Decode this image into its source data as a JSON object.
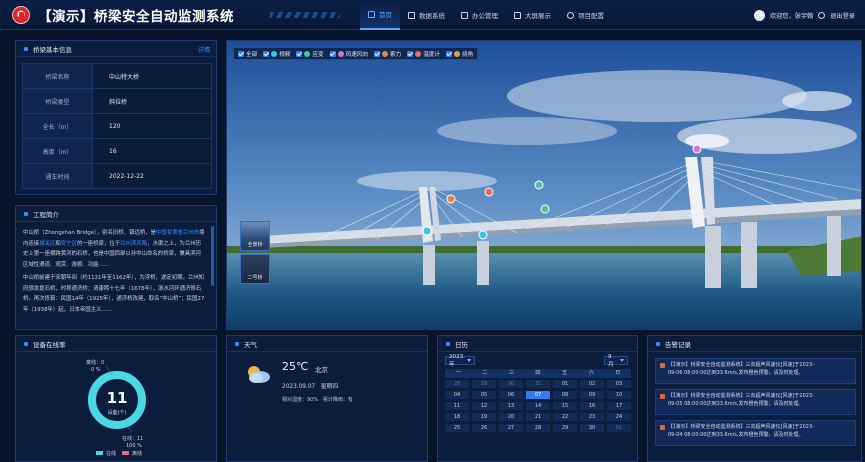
{
  "header": {
    "title": "【演示】桥梁安全自动监测系统",
    "nav": [
      {
        "label": "首页",
        "active": true
      },
      {
        "label": "数据系统",
        "active": false
      },
      {
        "label": "办公管理",
        "active": false
      },
      {
        "label": "大屏展示",
        "active": false
      },
      {
        "label": "项目配置",
        "active": false
      }
    ],
    "welcome": "欢迎您，张宇翰",
    "logout": "退出登录"
  },
  "bridge_info": {
    "title": "桥梁基本信息",
    "detail": "详情",
    "rows": [
      {
        "key": "桥梁名称",
        "value": "中山特大桥"
      },
      {
        "key": "桥梁类型",
        "value": "斜拉桥"
      },
      {
        "key": "全长（m）",
        "value": "120"
      },
      {
        "key": "高度（m）",
        "value": "16"
      },
      {
        "key": "通车时间",
        "value": "2022-12-22"
      }
    ]
  },
  "project_intro": {
    "title": "工程简介",
    "p1_a": "中山桥（Zhongshan Bridge），别名旧桥、镇远桥，是",
    "p1_link1": "中国甘肃省兰州市",
    "p1_b": "境内连接",
    "p1_link2": "城关区",
    "p1_c": "和",
    "p1_link3": "安宁区",
    "p1_d": "的一座桥梁，位于",
    "p1_link4": "兰州滨河路",
    "p1_e": "，水渠之上，为兰州历史上第一座横跨黄河的石桥，也是中国西部以孙中山命名的桥梁，兼具滨河区域性通道、观赏、游憩、功能……",
    "p2": "中山桥前建于宋朝年间（约1131年至1162年），为浮桥，遂定初期，兰州知府颁发提石桥，时称通济桥；清康熙十七年（1678年），浙水河环通济修石桥。再次修葺：民国14年（1925年），通济桥改建，取名“中山桥”；民国27年（1938年）起，日本帝国主义……"
  },
  "scene": {
    "layers": [
      "全部",
      "视频",
      "应变",
      "风速风向",
      "索力",
      "温度计",
      "挠角"
    ],
    "layer_colors": [
      "",
      "#36c6e8",
      "#50c2a0",
      "#d977d6",
      "#e0874a",
      "#e86a6a",
      "#e8a33a"
    ],
    "thumbs": [
      "全景桥",
      "二号桥"
    ],
    "markers": [
      "风速风向",
      "温度计",
      "应变",
      "索力",
      "视频",
      "挠角"
    ]
  },
  "device_rate": {
    "title": "设备在线率",
    "count": "11",
    "unit": "设备(个)",
    "offline_label": "离线：0",
    "offline_pct": "0 %",
    "online_label": "在线：11",
    "online_pct": "100 %",
    "legend_online": "在线",
    "legend_offline": "离线",
    "online_color": "#4ad9e4",
    "offline_color": "#e06a8a",
    "online_fraction": 1.0
  },
  "weather": {
    "title": "天气",
    "temp": "25℃",
    "city": "北京",
    "date": "2023.09.07",
    "weekday": "星期四",
    "humidity": "相对湿度：90%",
    "precip": "累计降雨：有"
  },
  "calendar": {
    "title": "日历",
    "year": "2023年",
    "month": "9月",
    "weekdays": [
      "一",
      "二",
      "三",
      "四",
      "五",
      "六",
      "日"
    ],
    "days": [
      {
        "d": "28",
        "m": true
      },
      {
        "d": "29",
        "m": true
      },
      {
        "d": "30",
        "m": true
      },
      {
        "d": "31",
        "m": true
      },
      {
        "d": "01"
      },
      {
        "d": "02"
      },
      {
        "d": "03"
      },
      {
        "d": "04"
      },
      {
        "d": "05"
      },
      {
        "d": "06"
      },
      {
        "d": "07",
        "t": true
      },
      {
        "d": "08"
      },
      {
        "d": "09"
      },
      {
        "d": "10"
      },
      {
        "d": "11"
      },
      {
        "d": "12"
      },
      {
        "d": "13"
      },
      {
        "d": "14"
      },
      {
        "d": "15"
      },
      {
        "d": "16"
      },
      {
        "d": "17"
      },
      {
        "d": "18"
      },
      {
        "d": "19"
      },
      {
        "d": "20"
      },
      {
        "d": "21"
      },
      {
        "d": "22"
      },
      {
        "d": "23"
      },
      {
        "d": "24"
      },
      {
        "d": "25"
      },
      {
        "d": "26"
      },
      {
        "d": "27"
      },
      {
        "d": "28"
      },
      {
        "d": "29"
      },
      {
        "d": "30"
      },
      {
        "d": "01",
        "m": true
      }
    ]
  },
  "alarms": {
    "title": "告警记录",
    "items": [
      {
        "line1": "【【演示】桥梁安全自动监测系统】三向超声风速仪[风速]于2023-",
        "line2": "09-06 08:00:00达到33.6m/s,发布橙色预警，请及时处理。"
      },
      {
        "line1": "【【演示】桥梁安全自动监测系统】三向超声风速仪[风速]于2023-",
        "line2": "09-05 08:00:00达到33.6m/s,发布橙色预警，请及时处理。"
      },
      {
        "line1": "【【演示】桥梁安全自动监测系统】三向超声风速仪[风速]于2023-",
        "line2": "09-04 08:00:00达到33.6m/s,发布橙色预警，请及时处理。"
      }
    ]
  }
}
